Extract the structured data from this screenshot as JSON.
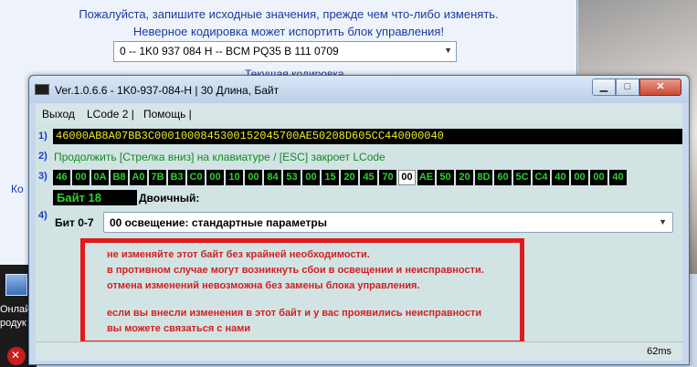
{
  "background_window": {
    "warning_line1": "Пожалуйста, запишите исходные значения, прежде чем что-либо изменять.",
    "warning_line2": "Неверное кодировка может испортить блок управления!",
    "module_select_value": "0 -- 1K0 937 084 H -- BCM PQ35  B    111 0709",
    "current_coding_label": "Текущая кодировка",
    "side_text": "Ко"
  },
  "desktop": {
    "icon1_label_line1": "Онлай",
    "icon1_label_line2": "родук"
  },
  "window": {
    "title": "Ver.1.0.6.6 -   1K0-937-084-H | 30 Длина, Байт",
    "min_glyph": "▁",
    "max_glyph": "□",
    "close_glyph": "✕"
  },
  "menu": {
    "items": [
      "Выход",
      "LCode 2 |",
      "Помощь |"
    ]
  },
  "rows": {
    "n1": "1)",
    "n2": "2)",
    "n3": "3)",
    "n4": "4)"
  },
  "coding_hex": "46000AB8A07BB3C0001000845300152045700AE50208D605CC440000040",
  "hint": "Продолжить [Стрелка вниз] на клавиатуре / [ESC] закроет LCode",
  "bytes": [
    "46",
    "00",
    "0A",
    "B8",
    "A0",
    "7B",
    "B3",
    "C0",
    "00",
    "10",
    "00",
    "84",
    "53",
    "00",
    "15",
    "20",
    "45",
    "70",
    "00",
    "AE",
    "50",
    "20",
    "8D",
    "60",
    "5C",
    "C4",
    "40",
    "00",
    "00",
    "40"
  ],
  "selected_byte_index": 18,
  "byte_badge": "Байт 18",
  "binary_label": "Двоичный:",
  "bit_label": "Бит 0-7",
  "dropdown_value": "00 освещение: стандартные параметры",
  "warning": {
    "line1": "не изменяйте этот байт без крайней необходимости.",
    "line2": "в противном случае могут возникнуть сбои в освещении и неисправности.",
    "line3": "отмена изменений невозможна без замены блока управления.",
    "line4": "если вы внесли изменения в этот байт и у вас проявились неисправности",
    "line5": "вы можете связаться с нами"
  },
  "status": {
    "time": "62ms"
  },
  "colors": {
    "hex_text": "#f0ec20",
    "byte_text": "#2ed02e",
    "warning_red": "#d32020",
    "hint_green": "#138a22"
  }
}
